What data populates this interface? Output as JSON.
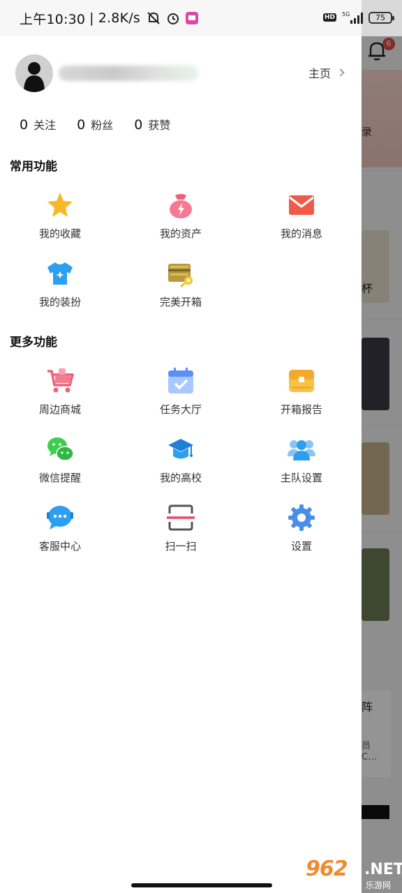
{
  "status_bar": {
    "time": "上午10:30",
    "speed": "2.8K/s",
    "network": "5G",
    "battery": "75",
    "hd": "HD"
  },
  "background_app": {
    "notification_count": "6",
    "login_text": "录",
    "cup_text": "杯",
    "array_text": "阵",
    "member_text": "员",
    "ellipsis_text": "C…"
  },
  "profile": {
    "home_link": "主页"
  },
  "stats": [
    {
      "num": "0",
      "label": "关注"
    },
    {
      "num": "0",
      "label": "粉丝"
    },
    {
      "num": "0",
      "label": "获赞"
    }
  ],
  "sections": {
    "common_title": "常用功能",
    "more_title": "更多功能"
  },
  "common_items": [
    {
      "label": "我的收藏",
      "icon": "star-icon"
    },
    {
      "label": "我的资产",
      "icon": "money-bag-icon"
    },
    {
      "label": "我的消息",
      "icon": "mail-icon"
    },
    {
      "label": "我的装扮",
      "icon": "tshirt-icon"
    },
    {
      "label": "完美开箱",
      "icon": "treasure-chest-icon"
    }
  ],
  "more_items": [
    {
      "label": "周边商城",
      "icon": "cart-icon"
    },
    {
      "label": "任务大厅",
      "icon": "calendar-check-icon"
    },
    {
      "label": "开箱报告",
      "icon": "box-report-icon"
    },
    {
      "label": "微信提醒",
      "icon": "wechat-icon"
    },
    {
      "label": "我的高校",
      "icon": "graduation-cap-icon"
    },
    {
      "label": "主队设置",
      "icon": "team-icon"
    },
    {
      "label": "客服中心",
      "icon": "customer-service-icon"
    },
    {
      "label": "扫一扫",
      "icon": "scan-icon"
    },
    {
      "label": "设置",
      "icon": "gear-icon"
    }
  ],
  "watermark": {
    "main": "962",
    "net": ".NET",
    "sub": "乐游网"
  },
  "colors": {
    "accent_red": "#e34b4b",
    "star_yellow": "#f7b928",
    "mail_red": "#f05a4a",
    "blue": "#2d9ff0",
    "green": "#3ccf4e"
  }
}
